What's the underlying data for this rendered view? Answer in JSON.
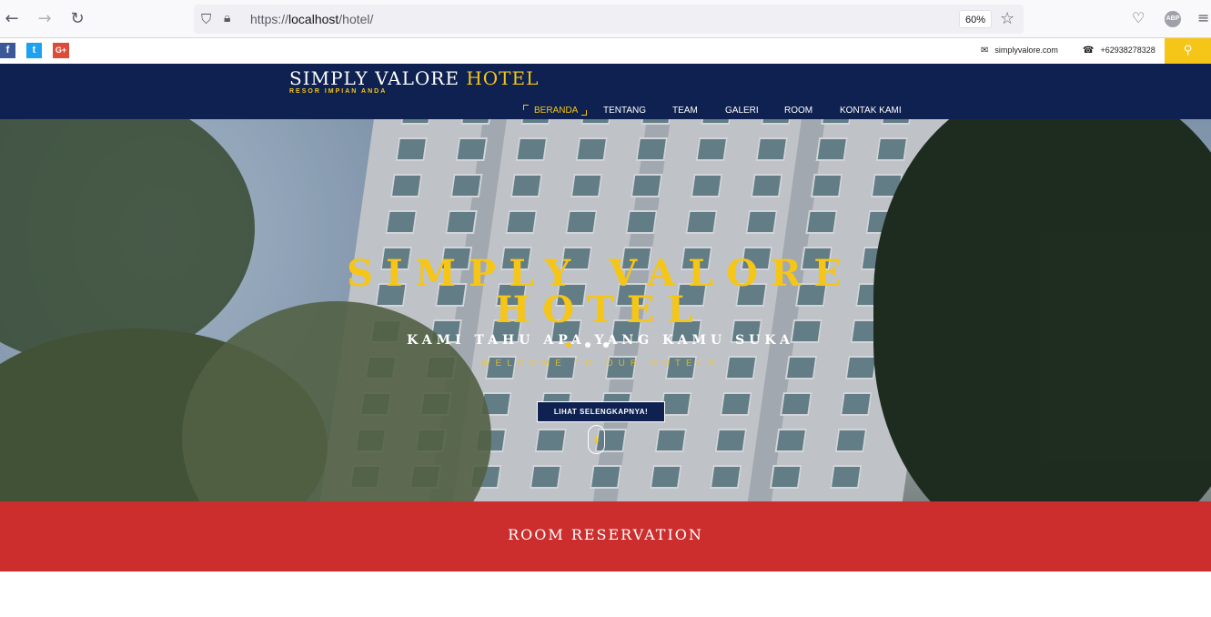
{
  "browser": {
    "url_prefix": "https://",
    "url_host": "localhost",
    "url_path": "/hotel/",
    "zoom": "60%",
    "abp_label": "ABP"
  },
  "topbar": {
    "social": [
      {
        "name": "facebook",
        "glyph": "f"
      },
      {
        "name": "twitter",
        "glyph": "t"
      },
      {
        "name": "google-plus",
        "glyph": "G+"
      }
    ],
    "email": "simplyvalore.com",
    "phone": "+62938278328"
  },
  "header": {
    "brand_main": "SIMPLY VALORE",
    "brand_accent": "HOTEL",
    "tagline": "RESOR IMPIAN ANDA",
    "menu": [
      "BERANDA",
      "TENTANG",
      "TEAM",
      "GALERI",
      "ROOM",
      "KONTAK KAMI"
    ],
    "active_menu": "BERANDA"
  },
  "hero": {
    "title_line1": "SIMPLY VALORE",
    "title_line2": "HOTEL",
    "subtitle": "KAMI TAHU APA YANG KAMU SUKA",
    "welcome": "WELCOME TO OUR HOTELS",
    "cta_label": "LIHAT SELENGKAPNYA!",
    "slide_count": 3,
    "active_slide": 1
  },
  "reservation": {
    "title": "ROOM RESERVATION"
  },
  "colors": {
    "navy": "#0e2150",
    "gold": "#f5c518",
    "red": "#cc2e2e"
  }
}
